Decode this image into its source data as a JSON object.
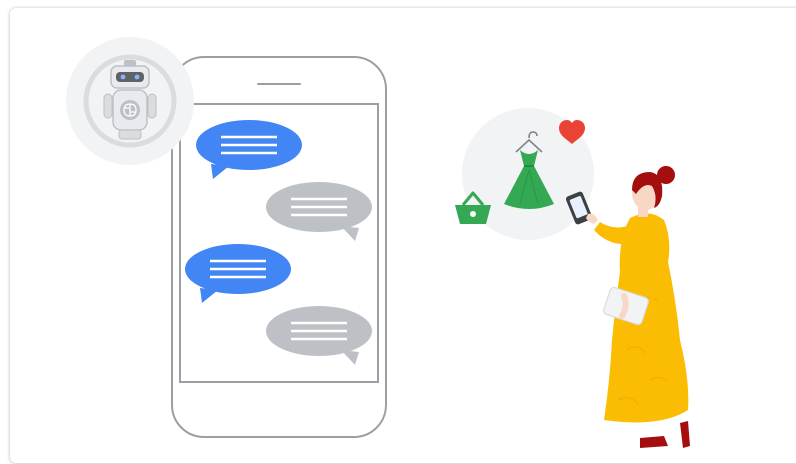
{
  "illustration": {
    "icons": {
      "robot": "robot-icon",
      "basket": "shopping-basket-icon",
      "dress": "dress-icon",
      "heart": "heart-icon",
      "person": "woman-with-phone"
    },
    "chat": {
      "messages": [
        {
          "from": "bot",
          "lines": 3
        },
        {
          "from": "user",
          "lines": 3
        },
        {
          "from": "bot",
          "lines": 3
        },
        {
          "from": "user",
          "lines": 3
        }
      ]
    },
    "colors": {
      "bot_bubble": "#4285F4",
      "user_bubble": "#BDC1C6",
      "basket": "#34A853",
      "dress": "#34A853",
      "heart": "#EA4335",
      "dress_outfit": "#FBBC04",
      "hair_and_shoes": "#A50E0E",
      "frame": "#9AA0A6"
    }
  }
}
